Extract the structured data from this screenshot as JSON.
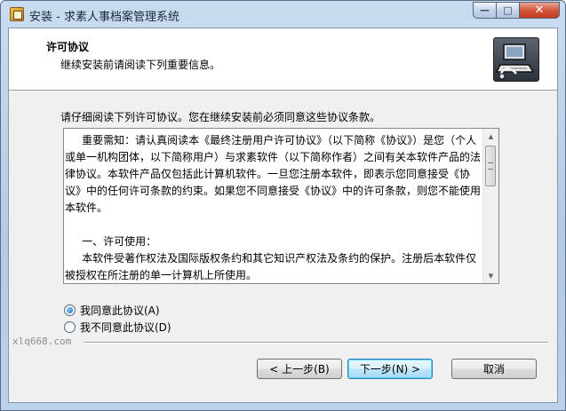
{
  "window": {
    "title": "安装 - 求素人事档案管理系统",
    "minimize_glyph": "—",
    "maximize_glyph": "□",
    "close_glyph": "✕",
    "icon": "installer-icon"
  },
  "header": {
    "title": "许可协议",
    "subtitle": "继续安装前请阅读下列重要信息。",
    "icon": "computer-install-icon"
  },
  "instructions": "请仔细阅读下列许可协议。您在继续安装前必须同意这些协议条款。",
  "license": {
    "text": "     重要需知：请认真阅读本《最终注册用户许可协议》（以下简称《协议》）是您（个人或单一机构团体，以下简称用户）与求素软件（以下简称作者）之间有关本软件产品的法律协议。本软件产品仅包括此计算机软件。一旦您注册本软件，即表示您同意接受《协议》中的任何许可条款的约束。如果您不同意接受《协议》中的许可条款，则您不能使用本软件。\n\n     一、许可使用：\n     本软件受著作权法及国际版权条约和其它知识产权法及条约的保护。注册后本软件仅被授权在所注册的单一计算机上所使用。"
  },
  "radios": [
    {
      "label": "我同意此协议(A)",
      "checked": true
    },
    {
      "label": "我不同意此协议(D)",
      "checked": false
    }
  ],
  "brand": "xlq668.com",
  "buttons": {
    "back": "< 上一步(B)",
    "next": "下一步(N) >",
    "cancel": "取消"
  }
}
